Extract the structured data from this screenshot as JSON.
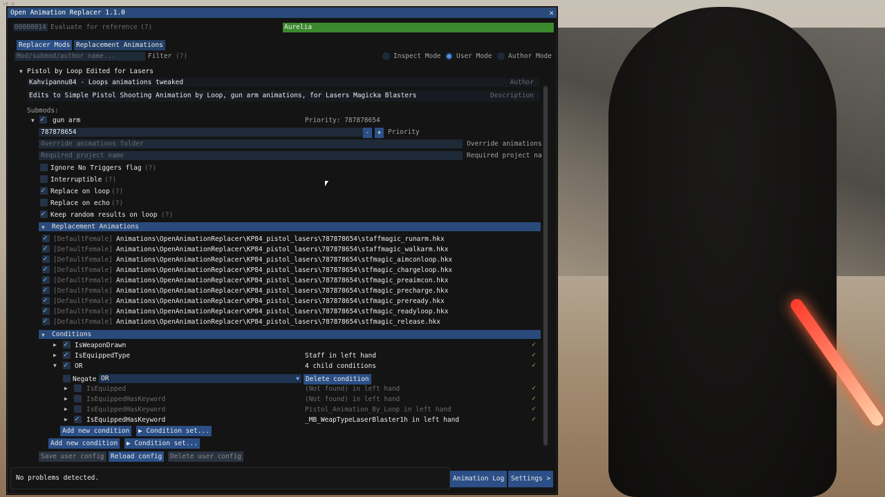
{
  "corner_text": "v0.0",
  "window": {
    "title": "Open Animation Replacer 1.1.0"
  },
  "ref": {
    "id": "00000014",
    "label": "Evaluate for reference",
    "help": "(?)",
    "target": "Aurelia"
  },
  "tabs": [
    "Replacer Mods",
    "Replacement Animations"
  ],
  "filter": {
    "placeholder": "Mod/submod/author name...",
    "label": "Filter",
    "help": "(?)"
  },
  "modes": [
    "Inspect Mode",
    "User Mode",
    "Author Mode"
  ],
  "mod": {
    "name": "Pistol by Loop Edited for Lasers",
    "author": "Kahvipannu84 - Loops animations tweaked",
    "author_label": "Author",
    "description": "Edits to Simple Pistol Shooting Animation by Loop, gun arm animations, for Lasers Magicka Blasters",
    "description_label": "Description"
  },
  "submods_label": "Submods:",
  "submod": {
    "name": "gun arm",
    "priority_text": "Priority: 787878654",
    "priority_value": "787878654",
    "minus": "-",
    "plus": "+",
    "priority_label": "Priority",
    "override_placeholder": "Override animations folder",
    "override_label": "Override animations",
    "project_placeholder": "Required project name",
    "project_label": "Required project na",
    "options": [
      {
        "label": "Ignore No Triggers flag",
        "help": "(?)",
        "checked": false
      },
      {
        "label": "Interruptible",
        "help": "(?)",
        "checked": false
      },
      {
        "label": "Replace on loop",
        "help": "(?)",
        "checked": true
      },
      {
        "label": "Replace on echo",
        "help": "(?)",
        "checked": false
      },
      {
        "label": "Keep random results on loop",
        "help": "(?)",
        "checked": true
      }
    ]
  },
  "replacement_header": "Replacement Animations",
  "animations": [
    {
      "tag": "[DefaultFemale]",
      "path": "Animations\\OpenAnimationReplacer\\KP84_pistol_lasers\\787878654\\staffmagic_runarm.hkx"
    },
    {
      "tag": "[DefaultFemale]",
      "path": "Animations\\OpenAnimationReplacer\\KP84_pistol_lasers\\787878654\\staffmagic_walkarm.hkx"
    },
    {
      "tag": "[DefaultFemale]",
      "path": "Animations\\OpenAnimationReplacer\\KP84_pistol_lasers\\787878654\\stfmagic_aimconloop.hkx"
    },
    {
      "tag": "[DefaultFemale]",
      "path": "Animations\\OpenAnimationReplacer\\KP84_pistol_lasers\\787878654\\stfmagic_chargeloop.hkx"
    },
    {
      "tag": "[DefaultFemale]",
      "path": "Animations\\OpenAnimationReplacer\\KP84_pistol_lasers\\787878654\\stfmagic_preaimcon.hkx"
    },
    {
      "tag": "[DefaultFemale]",
      "path": "Animations\\OpenAnimationReplacer\\KP84_pistol_lasers\\787878654\\stfmagic_precharge.hkx"
    },
    {
      "tag": "[DefaultFemale]",
      "path": "Animations\\OpenAnimationReplacer\\KP84_pistol_lasers\\787878654\\stfmagic_preready.hkx"
    },
    {
      "tag": "[DefaultFemale]",
      "path": "Animations\\OpenAnimationReplacer\\KP84_pistol_lasers\\787878654\\stfmagic_readyloop.hkx"
    },
    {
      "tag": "[DefaultFemale]",
      "path": "Animations\\OpenAnimationReplacer\\KP84_pistol_lasers\\787878654\\stfmagic_release.hkx"
    }
  ],
  "conditions_header": "Conditions",
  "conditions": [
    {
      "name": "IsWeaponDrawn",
      "value": ""
    },
    {
      "name": "IsEquippedType",
      "value": "Staff in left hand"
    },
    {
      "name": "OR",
      "value": "4 child conditions"
    }
  ],
  "negate": {
    "label": "Negate",
    "value": "OR",
    "delete": "Delete condition"
  },
  "child_conditions": [
    {
      "name": "IsEquipped",
      "value": "(Not found) in left hand",
      "checked": false
    },
    {
      "name": "IsEquippedHasKeyword",
      "value": "(Not found) in left hand",
      "checked": false
    },
    {
      "name": "IsEquippedHasKeyword",
      "value": "Pistol_Animation_By_Loop in left hand",
      "checked": false
    },
    {
      "name": "IsEquippedHasKeyword",
      "value": "_MB_WeapTypeLaserBlaster1h in left hand",
      "checked": true
    }
  ],
  "buttons": {
    "add_new_condition": "Add new condition",
    "condition_set": "▶ Condition set...",
    "save_user_config": "Save user config",
    "reload_config": "Reload config",
    "delete_user_config": "Delete user config",
    "animation_log": "Animation Log",
    "settings": "Settings >"
  },
  "status": "No problems detected.",
  "icons": {
    "check": "✓"
  }
}
